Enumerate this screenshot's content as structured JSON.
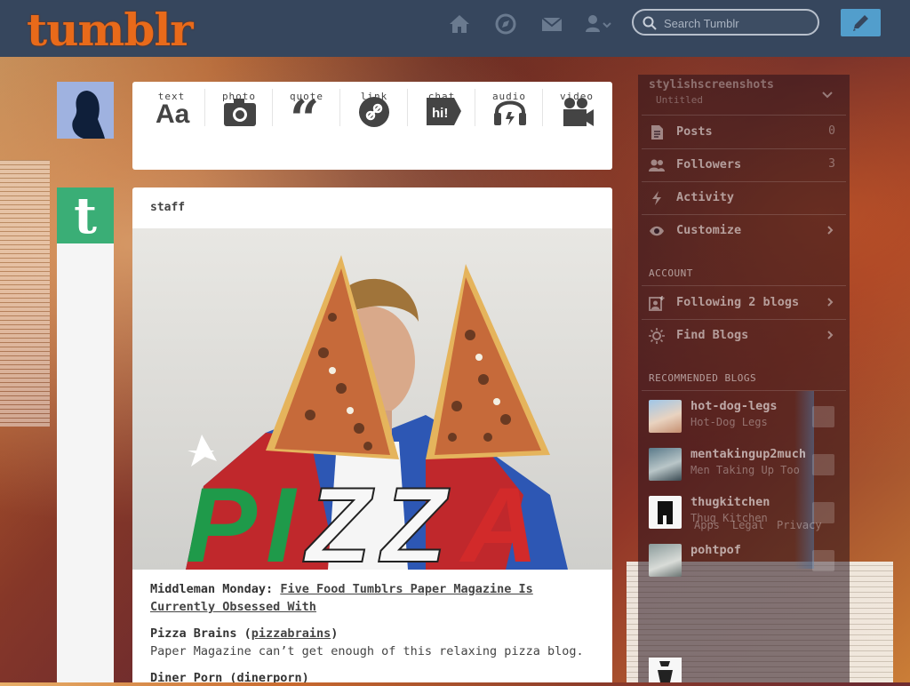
{
  "header": {
    "logo": "tumblr",
    "search": {
      "placeholder": "Search Tumblr"
    },
    "nav": [
      "home-icon",
      "explore-icon",
      "inbox-icon",
      "account-icon"
    ],
    "compose": "pencil-icon"
  },
  "post_types": [
    {
      "label": "text",
      "icon": "text-icon"
    },
    {
      "label": "photo",
      "icon": "camera-icon"
    },
    {
      "label": "quote",
      "icon": "quote-icon"
    },
    {
      "label": "link",
      "icon": "link-icon"
    },
    {
      "label": "chat",
      "icon": "chat-icon"
    },
    {
      "label": "audio",
      "icon": "headphones-icon"
    },
    {
      "label": "video",
      "icon": "video-camera-icon"
    }
  ],
  "post": {
    "author": "staff",
    "image_text": "PIZZA",
    "body": {
      "intro_prefix": "Middleman Monday: ",
      "intro_link": "Five Food Tumblrs Paper Magazine Is Currently Obsessed With",
      "item1_title_prefix": "Pizza Brains (",
      "item1_link": "pizzabrains",
      "item1_title_suffix": ")",
      "item1_desc": "Paper Magazine can’t get enough of this relaxing pizza blog.",
      "item2_title": "Diner Porn (dinerporn)"
    }
  },
  "sidebar": {
    "blog_name": "stylishscreenshots",
    "blog_subtitle": "Untitled",
    "rows": [
      {
        "label": "Posts",
        "count": "0",
        "icon": "posts-icon"
      },
      {
        "label": "Followers",
        "count": "3",
        "icon": "followers-icon"
      },
      {
        "label": "Activity",
        "count": "",
        "icon": "activity-icon"
      },
      {
        "label": "Customize",
        "count": "",
        "icon": "eye-icon"
      }
    ],
    "account_title": "ACCOUNT",
    "account_rows": [
      {
        "label": "Following 2 blogs",
        "icon": "following-icon"
      },
      {
        "label": "Find Blogs",
        "icon": "find-blogs-icon"
      }
    ],
    "recommended_title": "RECOMMENDED BLOGS",
    "recommended": [
      {
        "name": "hot-dog-legs",
        "title": "Hot-Dog Legs"
      },
      {
        "name": "mentakingup2much",
        "title": "Men Taking Up Too"
      },
      {
        "name": "thugkitchen",
        "title": "Thug Kitchen"
      },
      {
        "name": "pohtpof",
        "title": ""
      }
    ],
    "footer": [
      "Apps",
      "Legal",
      "Privacy"
    ]
  }
}
